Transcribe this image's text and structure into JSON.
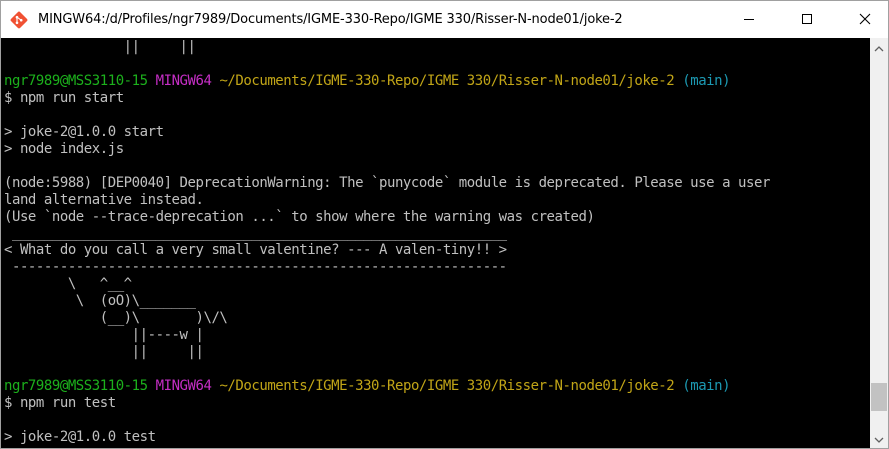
{
  "window": {
    "title": "MINGW64:/d/Profiles/ngr7989/Documents/IGME-330-Repo/IGME 330/Risser-N-node01/joke-2",
    "icon": "git-bash-icon",
    "buttons": [
      "minimize-icon",
      "maximize-icon",
      "close-icon"
    ]
  },
  "terminal": {
    "colors": {
      "background": "#000000",
      "text": "#c0c0c0",
      "user_host": "#1cb11c",
      "mingw": "#c52ec5",
      "path": "#c1a517",
      "branch": "#1c9ab3"
    },
    "lines": [
      {
        "segments": [
          {
            "text": "               ||     ||",
            "color": "gray"
          }
        ]
      },
      {
        "segments": []
      },
      {
        "segments": [
          {
            "text": "ngr7989@MSS3110-15",
            "color": "green"
          },
          {
            "text": " ",
            "color": "gray"
          },
          {
            "text": "MINGW64",
            "color": "magenta"
          },
          {
            "text": " ",
            "color": "gray"
          },
          {
            "text": "~/Documents/IGME-330-Repo/IGME 330/Risser-N-node01/joke-2",
            "color": "yellow"
          },
          {
            "text": " ",
            "color": "gray"
          },
          {
            "text": "(main)",
            "color": "cyan"
          }
        ]
      },
      {
        "segments": [
          {
            "text": "$ npm run start",
            "color": "gray"
          }
        ]
      },
      {
        "segments": []
      },
      {
        "segments": [
          {
            "text": "> joke-2@1.0.0 start",
            "color": "gray"
          }
        ]
      },
      {
        "segments": [
          {
            "text": "> node index.js",
            "color": "gray"
          }
        ]
      },
      {
        "segments": []
      },
      {
        "segments": [
          {
            "text": "(node:5988) [DEP0040] DeprecationWarning: The `punycode` module is deprecated. Please use a user",
            "color": "gray"
          }
        ]
      },
      {
        "segments": [
          {
            "text": "land alternative instead.",
            "color": "gray"
          }
        ]
      },
      {
        "segments": [
          {
            "text": "(Use `node --trace-deprecation ...` to show where the warning was created)",
            "color": "gray"
          }
        ]
      },
      {
        "segments": [
          {
            "text": " ______________________________________________________________",
            "color": "gray"
          }
        ]
      },
      {
        "segments": [
          {
            "text": "< What do you call a very small valentine? --- A valen-tiny!! >",
            "color": "gray"
          }
        ]
      },
      {
        "segments": [
          {
            "text": " --------------------------------------------------------------",
            "color": "gray"
          }
        ]
      },
      {
        "segments": [
          {
            "text": "        \\   ^__^",
            "color": "gray"
          }
        ]
      },
      {
        "segments": [
          {
            "text": "         \\  (oO)\\_______",
            "color": "gray"
          }
        ]
      },
      {
        "segments": [
          {
            "text": "            (__)\\       )\\/\\",
            "color": "gray"
          }
        ]
      },
      {
        "segments": [
          {
            "text": "                ||----w |",
            "color": "gray"
          }
        ]
      },
      {
        "segments": [
          {
            "text": "                ||     ||",
            "color": "gray"
          }
        ]
      },
      {
        "segments": []
      },
      {
        "segments": [
          {
            "text": "ngr7989@MSS3110-15",
            "color": "green"
          },
          {
            "text": " ",
            "color": "gray"
          },
          {
            "text": "MINGW64",
            "color": "magenta"
          },
          {
            "text": " ",
            "color": "gray"
          },
          {
            "text": "~/Documents/IGME-330-Repo/IGME 330/Risser-N-node01/joke-2",
            "color": "yellow"
          },
          {
            "text": " ",
            "color": "gray"
          },
          {
            "text": "(main)",
            "color": "cyan"
          }
        ]
      },
      {
        "segments": [
          {
            "text": "$ npm run test",
            "color": "gray"
          }
        ]
      },
      {
        "segments": []
      },
      {
        "segments": [
          {
            "text": "> joke-2@1.0.0 test",
            "color": "gray"
          }
        ]
      }
    ]
  },
  "scrollbar": {
    "up": "chevron-up-icon",
    "down": "chevron-down-icon"
  }
}
